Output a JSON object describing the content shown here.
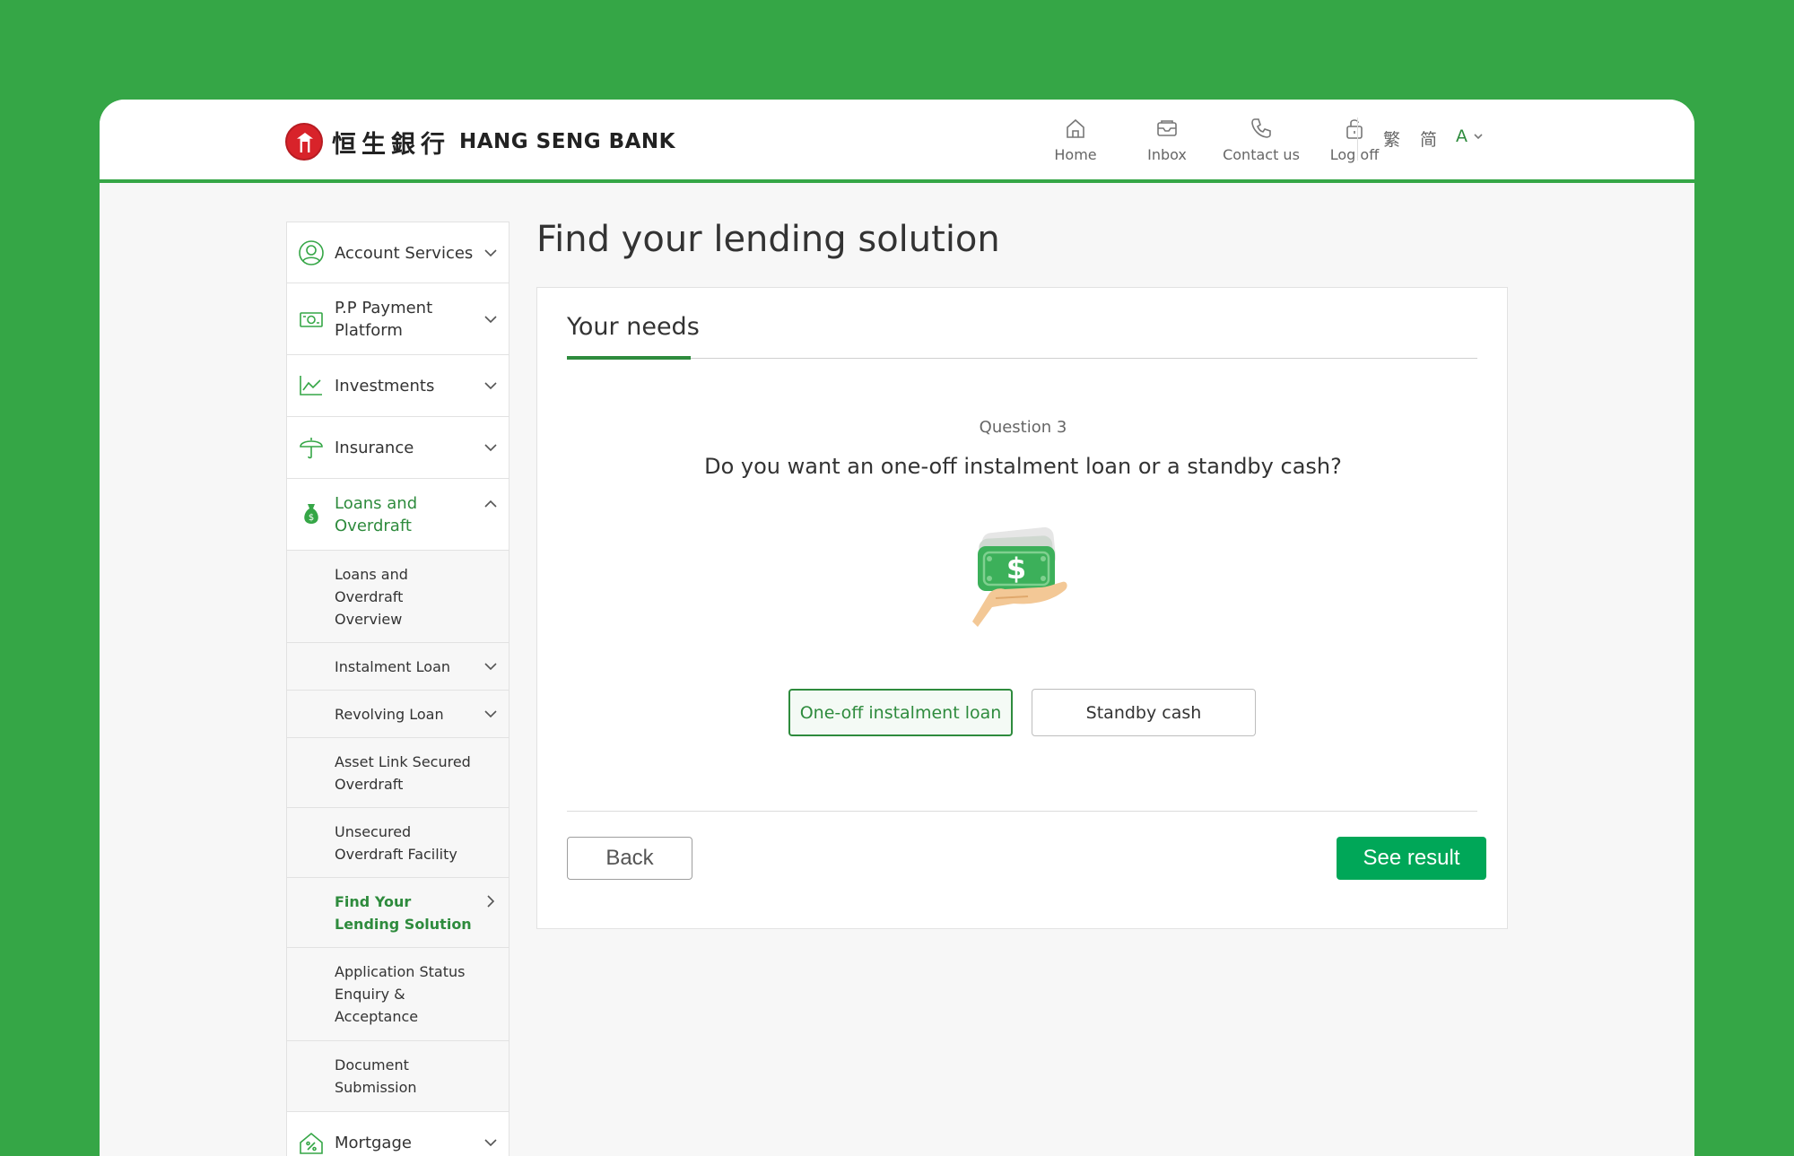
{
  "header": {
    "logo_cn": "恒生銀行",
    "logo_en": "HANG SENG BANK",
    "nav": [
      {
        "label": "Home",
        "icon": "home-icon"
      },
      {
        "label": "Inbox",
        "icon": "inbox-icon"
      },
      {
        "label": "Contact us",
        "icon": "phone-icon"
      },
      {
        "label": "Log off",
        "icon": "unlock-icon"
      }
    ],
    "lang_trad": "繁",
    "lang_simp": "简",
    "font_size": "A"
  },
  "sidebar": {
    "items": [
      {
        "label": "Account Services",
        "icon": "user-circle-icon"
      },
      {
        "label": "P.P Payment Platform",
        "icon": "payment-icon"
      },
      {
        "label": "Investments",
        "icon": "chart-line-icon"
      },
      {
        "label": "Insurance",
        "icon": "umbrella-icon"
      },
      {
        "label": "Loans and Overdraft",
        "icon": "money-bag-icon"
      },
      {
        "label": "Mortgage",
        "icon": "house-percent-icon"
      }
    ],
    "subitems": [
      {
        "label": "Loans and Overdraft Overview"
      },
      {
        "label": "Instalment Loan"
      },
      {
        "label": "Revolving Loan"
      },
      {
        "label": "Asset Link Secured Overdraft"
      },
      {
        "label": "Unsecured Overdraft Facility"
      },
      {
        "label": "Find Your Lending Solution"
      },
      {
        "label": "Application Status Enquiry & Acceptance"
      },
      {
        "label": "Document Submission"
      }
    ]
  },
  "main": {
    "title": "Find your lending solution",
    "tab": "Your needs",
    "question_number": "Question 3",
    "question": "Do you want an one-off instalment loan or a standby cash?",
    "illustration": "hand-holding-cash-icon",
    "options": [
      {
        "label": "One-off instalment loan",
        "selected": true
      },
      {
        "label": "Standby cash",
        "selected": false
      }
    ],
    "back_label": "Back",
    "result_label": "See result"
  },
  "colors": {
    "brand_green": "#35a646",
    "accent_green": "#2e8b3d",
    "button_green": "#00a758",
    "logo_red": "#d8232a"
  }
}
